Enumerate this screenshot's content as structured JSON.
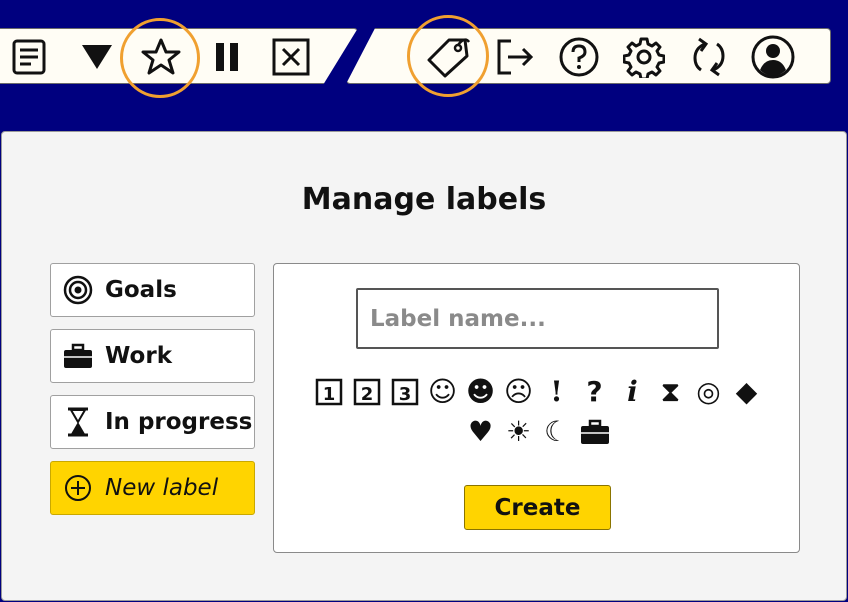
{
  "toolbar": {
    "left_buttons": [
      {
        "name": "menu-icon"
      },
      {
        "name": "dropdown-arrow-icon"
      },
      {
        "name": "star-icon"
      },
      {
        "name": "pause-icon"
      },
      {
        "name": "close-box-icon"
      }
    ],
    "right_buttons": [
      {
        "name": "tag-icon"
      },
      {
        "name": "exit-icon"
      },
      {
        "name": "help-icon"
      },
      {
        "name": "gear-icon"
      },
      {
        "name": "sync-icon"
      },
      {
        "name": "user-icon"
      }
    ],
    "highlight_color": "#f0a030"
  },
  "dialog": {
    "title": "Manage labels",
    "labels": [
      {
        "text": "Goals",
        "icon": "target-icon"
      },
      {
        "text": "Work",
        "icon": "briefcase-icon"
      },
      {
        "text": "In progress",
        "icon": "hourglass-icon"
      }
    ],
    "new_label": "New label",
    "input_placeholder": "Label name...",
    "input_value": "",
    "icon_choices": [
      {
        "glyph": "1",
        "name": "box-1-icon"
      },
      {
        "glyph": "2",
        "name": "box-2-icon"
      },
      {
        "glyph": "3",
        "name": "box-3-icon"
      },
      {
        "glyph": "☺",
        "name": "smile-icon"
      },
      {
        "glyph": "☻",
        "name": "grin-icon"
      },
      {
        "glyph": "☹",
        "name": "frown-icon"
      },
      {
        "glyph": "!",
        "name": "exclamation-icon"
      },
      {
        "glyph": "?",
        "name": "question-icon"
      },
      {
        "glyph": "i",
        "name": "info-icon"
      },
      {
        "glyph": "⧗",
        "name": "hourglass-icon"
      },
      {
        "glyph": "◎",
        "name": "target-icon"
      },
      {
        "glyph": "◆",
        "name": "diamond-icon"
      },
      {
        "glyph": "♥",
        "name": "heart-icon"
      },
      {
        "glyph": "☀",
        "name": "sun-icon"
      },
      {
        "glyph": "☾",
        "name": "moon-icon"
      },
      {
        "glyph": "",
        "name": "briefcase-icon"
      }
    ],
    "create_label": "Create",
    "accent": "#ffd400"
  }
}
